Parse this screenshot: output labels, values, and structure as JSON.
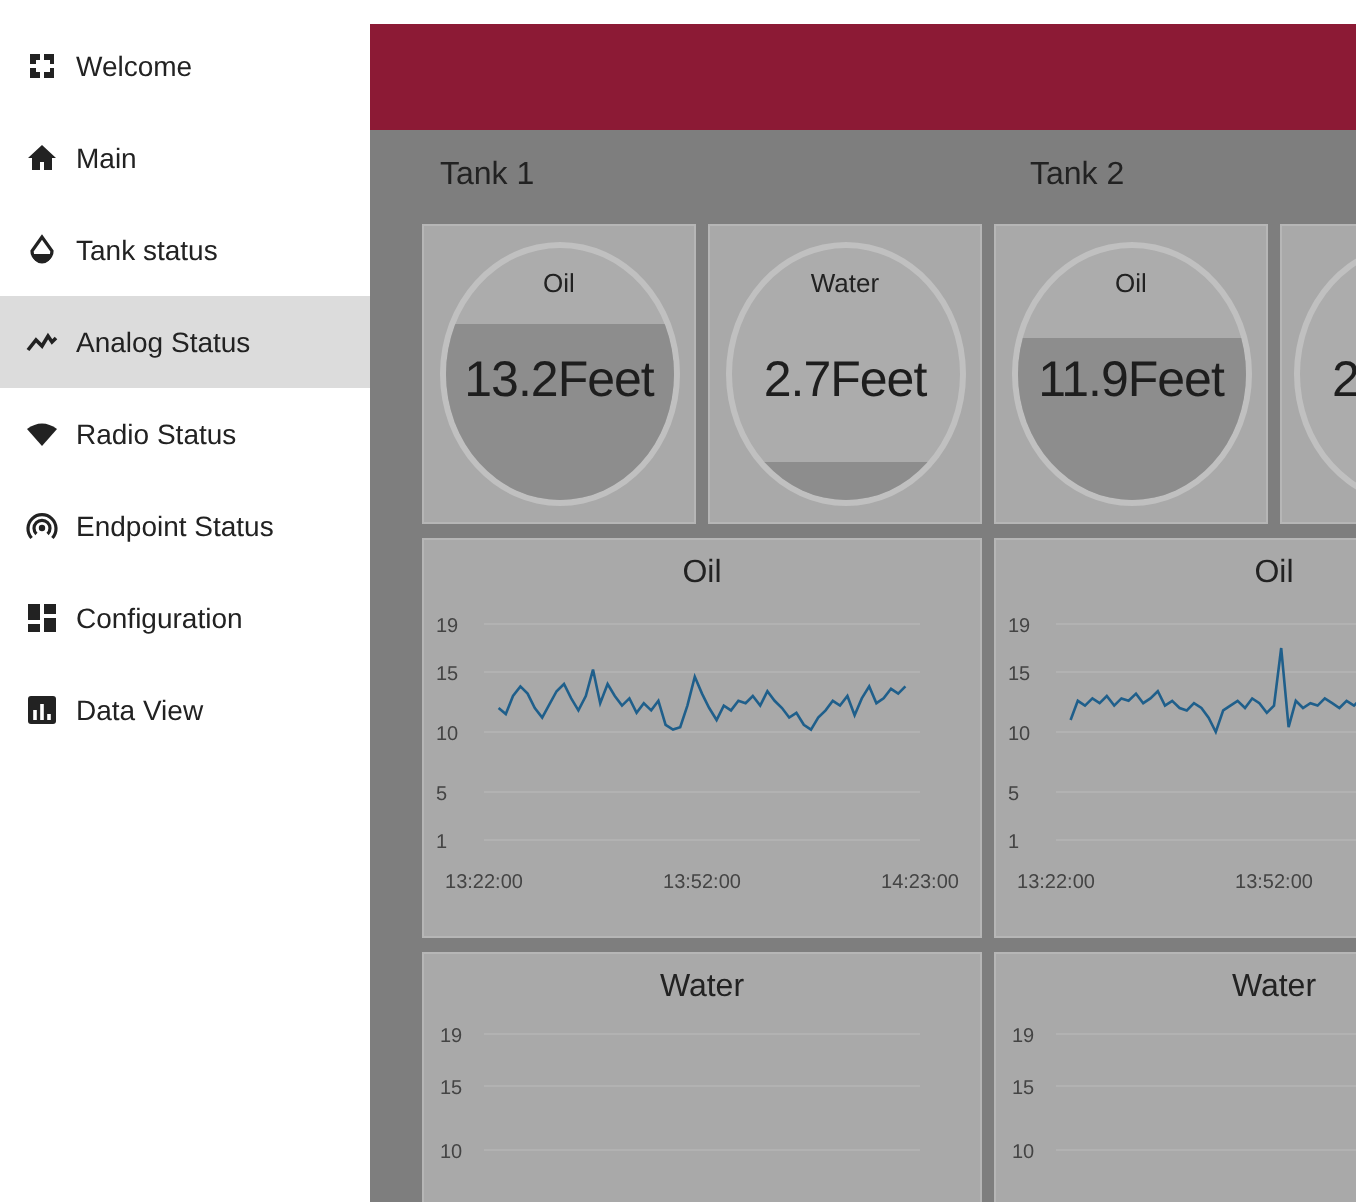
{
  "sidebar": {
    "items": [
      {
        "label": "Welcome",
        "selected": false
      },
      {
        "label": "Main",
        "selected": false
      },
      {
        "label": "Tank status",
        "selected": false
      },
      {
        "label": "Analog Status",
        "selected": true
      },
      {
        "label": "Radio Status",
        "selected": false
      },
      {
        "label": "Endpoint Status",
        "selected": false
      },
      {
        "label": "Configuration",
        "selected": false
      },
      {
        "label": "Data View",
        "selected": false
      }
    ]
  },
  "tanks": [
    {
      "title": "Tank 1"
    },
    {
      "title": "Tank 2"
    }
  ],
  "gauges": [
    {
      "label": "Oil",
      "value": "13.2Feet",
      "level": 0.7
    },
    {
      "label": "Water",
      "value": "2.7Feet",
      "level": 0.15
    },
    {
      "label": "Oil",
      "value": "11.9Feet",
      "level": 0.64
    },
    {
      "value": "2"
    }
  ],
  "charts": [
    {
      "chart_data": {
        "type": "line",
        "title": "Oil",
        "grid": true,
        "ylim": [
          1,
          19
        ],
        "yticks": [
          1,
          5,
          10,
          15,
          19
        ],
        "categories": [
          "13:22:00",
          null,
          null,
          null,
          null,
          null,
          null,
          null,
          null,
          null,
          null,
          null,
          null,
          null,
          null,
          null,
          null,
          null,
          null,
          null,
          null,
          null,
          null,
          null,
          null,
          null,
          null,
          null,
          null,
          null,
          "13:52:00",
          null,
          null,
          null,
          null,
          null,
          null,
          null,
          null,
          null,
          null,
          null,
          null,
          null,
          null,
          null,
          null,
          null,
          null,
          null,
          null,
          null,
          null,
          null,
          null,
          null,
          null,
          null,
          null,
          null,
          "14:23:00"
        ],
        "series": [
          {
            "color": "#1f5f8b",
            "values": [
              null,
              null,
              12,
              11.5,
              13,
              13.8,
              13.2,
              12,
              11.2,
              12.3,
              13.4,
              14,
              12.8,
              11.8,
              13,
              15.2,
              12.4,
              14,
              13,
              12.2,
              12.8,
              11.6,
              12.4,
              11.8,
              12.6,
              10.6,
              10.2,
              10.4,
              12.2,
              14.6,
              13.2,
              12,
              11,
              12.2,
              11.8,
              12.6,
              12.4,
              13,
              12.2,
              13.4,
              12.6,
              12,
              11.2,
              11.6,
              10.6,
              10.2,
              11.2,
              11.8,
              12.6,
              12.2,
              13,
              11.4,
              12.8,
              13.8,
              12.4,
              12.8,
              13.6,
              13.2,
              13.8,
              null,
              null
            ]
          }
        ]
      }
    },
    {
      "chart_data": {
        "type": "line",
        "title": "Oil",
        "grid": true,
        "ylim": [
          1,
          19
        ],
        "yticks": [
          1,
          5,
          10,
          15,
          19
        ],
        "categories": [
          "13:22:00",
          null,
          null,
          null,
          null,
          null,
          null,
          null,
          null,
          null,
          null,
          null,
          null,
          null,
          null,
          null,
          null,
          null,
          null,
          null,
          null,
          null,
          null,
          null,
          null,
          null,
          null,
          null,
          null,
          null,
          "13:52:00",
          null,
          null,
          null,
          null,
          null,
          null,
          null,
          null,
          null,
          null,
          null,
          null,
          null,
          null,
          null,
          null,
          null,
          null,
          null,
          null,
          null,
          null,
          null,
          null,
          null,
          null,
          null,
          null,
          null,
          null
        ],
        "series": [
          {
            "color": "#1f5f8b",
            "values": [
              null,
              null,
              11,
              12.6,
              12.2,
              12.8,
              12.4,
              13,
              12.2,
              12.8,
              12.6,
              13.2,
              12.4,
              12.8,
              13.4,
              12.2,
              12.6,
              12,
              11.8,
              12.4,
              12,
              11.2,
              10,
              11.8,
              12.2,
              12.6,
              12,
              12.8,
              12.4,
              11.6,
              12.2,
              17,
              10.4,
              12.6,
              12,
              12.4,
              12.2,
              12.8,
              12.4,
              12,
              12.6,
              12.2,
              12.8,
              null,
              null,
              null,
              null,
              null,
              null,
              null,
              null,
              null,
              null,
              null,
              null,
              null,
              null,
              null,
              null,
              null,
              null
            ]
          }
        ]
      }
    },
    {
      "title": "Water",
      "y_labels": [
        "19",
        "15",
        "10"
      ]
    },
    {
      "title": "Water",
      "y_labels": [
        "19",
        "15",
        "10"
      ]
    }
  ]
}
